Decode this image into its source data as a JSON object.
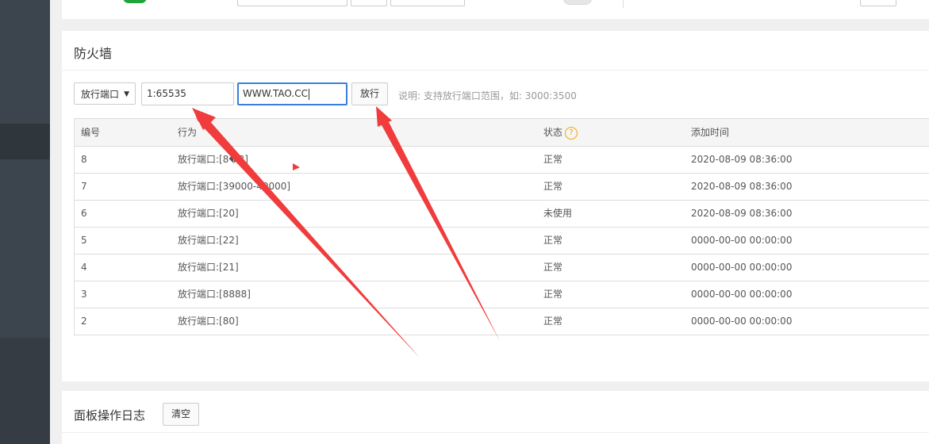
{
  "firewall": {
    "title": "防火墙",
    "mode_select": "放行端口",
    "port_value": "1:65535",
    "ip_value": "WWW.TAO.CC",
    "allow_button": "放行",
    "hint": "说明: 支持放行端口范围，如: 3000:3500",
    "columns": [
      "编号",
      "行为",
      "状态",
      "添加时间"
    ],
    "help_glyph": "?",
    "rows": [
      {
        "id": "8",
        "action": "放行端口:[8�3]",
        "status": "正常",
        "time": "2020-08-09 08:36:00"
      },
      {
        "id": "7",
        "action": "放行端口:[39000-40000]",
        "status": "正常",
        "time": "2020-08-09 08:36:00"
      },
      {
        "id": "6",
        "action": "放行端口:[20]",
        "status": "未使用",
        "time": "2020-08-09 08:36:00"
      },
      {
        "id": "5",
        "action": "放行端口:[22]",
        "status": "正常",
        "time": "0000-00-00 00:00:00"
      },
      {
        "id": "4",
        "action": "放行端口:[21]",
        "status": "正常",
        "time": "0000-00-00 00:00:00"
      },
      {
        "id": "3",
        "action": "放行端口:[8888]",
        "status": "正常",
        "time": "0000-00-00 00:00:00"
      },
      {
        "id": "2",
        "action": "放行端口:[80]",
        "status": "正常",
        "time": "0000-00-00 00:00:00"
      }
    ]
  },
  "log_panel": {
    "title": "面板操作日志",
    "clear_button": "清空"
  },
  "colors": {
    "accent_green": "#20a53a",
    "focus_blue": "#3c7edb",
    "help_orange": "#f0a30a",
    "annotation_red": "#f03c3c",
    "sidebar": "#3c444d"
  },
  "icons": [
    "help-icon",
    "dropdown-arrow-icon"
  ]
}
